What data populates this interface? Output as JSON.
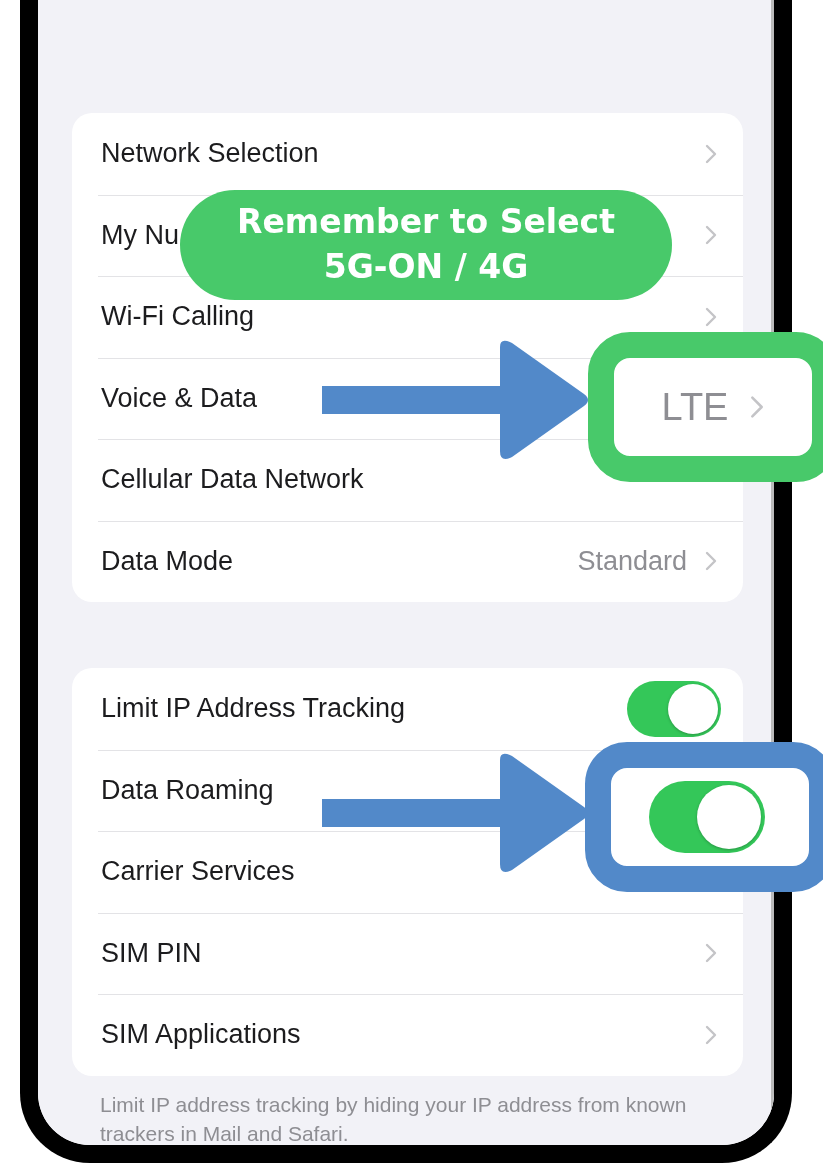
{
  "groups": [
    {
      "rows": [
        {
          "label": "Network Selection",
          "kind": "chevron"
        },
        {
          "label": "My Nu",
          "kind": "chevron"
        },
        {
          "label": "Wi-Fi Calling",
          "kind": "chevron"
        },
        {
          "label": "Voice & Data",
          "kind": "plain"
        },
        {
          "label": "Cellular Data Network",
          "kind": "plain"
        },
        {
          "label": "Data Mode",
          "kind": "chevron",
          "value": "Standard"
        }
      ]
    },
    {
      "rows": [
        {
          "label": "Limit IP Address Tracking",
          "kind": "toggle",
          "on": true
        },
        {
          "label": "Data Roaming",
          "kind": "plain"
        },
        {
          "label": "Carrier Services",
          "kind": "plain"
        },
        {
          "label": "SIM PIN",
          "kind": "chevron"
        },
        {
          "label": "SIM Applications",
          "kind": "chevron"
        }
      ],
      "footer": "Limit IP address tracking by hiding your IP address from known trackers in Mail and Safari."
    }
  ],
  "callout": {
    "text": "Remember to Select 5G-ON / 4G"
  },
  "highlights": [
    {
      "kind": "value",
      "value": "LTE",
      "color": "#48c96a"
    },
    {
      "kind": "toggle",
      "on": true,
      "color": "#5289c9"
    }
  ]
}
